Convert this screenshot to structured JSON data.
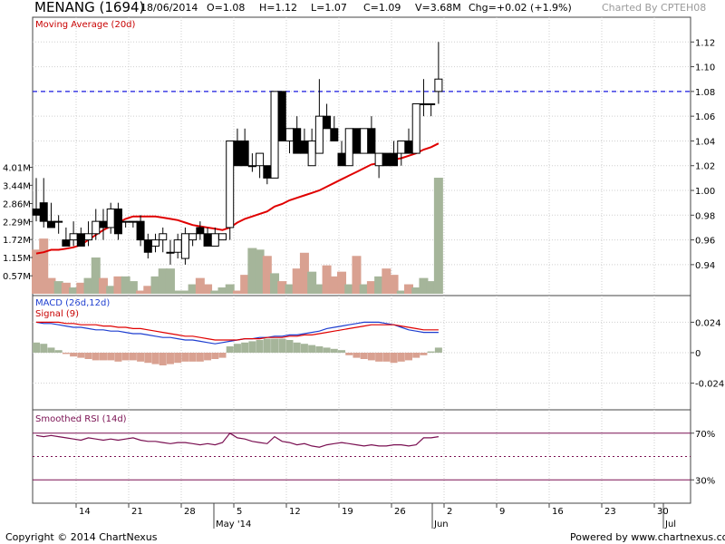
{
  "header": {
    "symbol": "MENANG (1694)",
    "date": "18/06/2014",
    "open": "O=1.08",
    "high": "H=1.12",
    "low": "L=1.07",
    "close": "C=1.09",
    "volume": "V=3.68M",
    "change": "Chg=+0.02 (+1.9%)",
    "charted_by": "Charted By CPTEH08"
  },
  "footer": {
    "copyright": "Copyright © 2014 ChartNexus",
    "powered_by": "Powered by www.chartnexus.com"
  },
  "colors": {
    "up_candle": "#ffffff",
    "down_candle": "#000000",
    "ma_line": "#e00000",
    "vol_up": "#a5b59a",
    "vol_down": "#d9a191",
    "macd_line": "#1f3fd0",
    "signal_line": "#e00000",
    "rsi_line": "#7a1052",
    "resistance": "#1a1adf"
  },
  "chart_data": [
    {
      "type": "candlestick",
      "title": "Moving Average (20d)",
      "ylim": [
        0.915,
        1.14
      ],
      "y_ticks": [
        "1.12",
        "1.10",
        "1.08",
        "1.06",
        "1.04",
        "1.02",
        "1.00",
        "0.98",
        "0.96",
        "0.94"
      ],
      "resistance_level": 1.08,
      "x_tick_labels": [
        "14",
        "21",
        "28",
        "5",
        "12",
        "19",
        "26",
        "2",
        "9",
        "16",
        "23",
        "30"
      ],
      "month_labels": [
        "May '14",
        "Jun",
        "Jul"
      ],
      "candles": [
        {
          "o": 0.985,
          "h": 1.01,
          "l": 0.975,
          "c": 0.98
        },
        {
          "o": 0.99,
          "h": 1.01,
          "l": 0.97,
          "c": 0.975
        },
        {
          "o": 0.975,
          "h": 0.99,
          "l": 0.97,
          "c": 0.97
        },
        {
          "o": 0.975,
          "h": 0.98,
          "l": 0.965,
          "c": 0.975
        },
        {
          "o": 0.96,
          "h": 0.97,
          "l": 0.955,
          "c": 0.955
        },
        {
          "o": 0.96,
          "h": 0.975,
          "l": 0.955,
          "c": 0.965
        },
        {
          "o": 0.965,
          "h": 0.97,
          "l": 0.955,
          "c": 0.955
        },
        {
          "o": 0.96,
          "h": 0.975,
          "l": 0.955,
          "c": 0.965
        },
        {
          "o": 0.965,
          "h": 0.985,
          "l": 0.96,
          "c": 0.975
        },
        {
          "o": 0.975,
          "h": 0.985,
          "l": 0.96,
          "c": 0.97
        },
        {
          "o": 0.97,
          "h": 0.99,
          "l": 0.965,
          "c": 0.985
        },
        {
          "o": 0.985,
          "h": 0.99,
          "l": 0.96,
          "c": 0.965
        },
        {
          "o": 0.975,
          "h": 0.975,
          "l": 0.97,
          "c": 0.975
        },
        {
          "o": 0.975,
          "h": 0.975,
          "l": 0.97,
          "c": 0.975
        },
        {
          "o": 0.975,
          "h": 0.98,
          "l": 0.955,
          "c": 0.96
        },
        {
          "o": 0.96,
          "h": 0.965,
          "l": 0.945,
          "c": 0.95
        },
        {
          "o": 0.955,
          "h": 0.965,
          "l": 0.95,
          "c": 0.96
        },
        {
          "o": 0.96,
          "h": 0.97,
          "l": 0.95,
          "c": 0.965
        },
        {
          "o": 0.95,
          "h": 0.96,
          "l": 0.94,
          "c": 0.95
        },
        {
          "o": 0.95,
          "h": 0.965,
          "l": 0.945,
          "c": 0.96
        },
        {
          "o": 0.945,
          "h": 0.97,
          "l": 0.94,
          "c": 0.965
        },
        {
          "o": 0.96,
          "h": 0.965,
          "l": 0.955,
          "c": 0.965
        },
        {
          "o": 0.97,
          "h": 0.975,
          "l": 0.96,
          "c": 0.965
        },
        {
          "o": 0.965,
          "h": 0.97,
          "l": 0.96,
          "c": 0.955
        },
        {
          "o": 0.955,
          "h": 0.97,
          "l": 0.955,
          "c": 0.965
        },
        {
          "o": 0.96,
          "h": 0.965,
          "l": 0.96,
          "c": 0.965
        },
        {
          "o": 0.97,
          "h": 1.02,
          "l": 0.96,
          "c": 1.04
        },
        {
          "o": 1.04,
          "h": 1.05,
          "l": 1.02,
          "c": 1.02
        },
        {
          "o": 1.04,
          "h": 1.05,
          "l": 1.02,
          "c": 1.02
        },
        {
          "o": 1.02,
          "h": 1.03,
          "l": 1.015,
          "c": 1.02
        },
        {
          "o": 1.02,
          "h": 1.03,
          "l": 1.01,
          "c": 1.03
        },
        {
          "o": 1.02,
          "h": 1.02,
          "l": 1.005,
          "c": 1.01
        },
        {
          "o": 1.01,
          "h": 1.08,
          "l": 1.01,
          "c": 1.08
        },
        {
          "o": 1.08,
          "h": 1.08,
          "l": 1.04,
          "c": 1.04
        },
        {
          "o": 1.04,
          "h": 1.05,
          "l": 1.03,
          "c": 1.05
        },
        {
          "o": 1.05,
          "h": 1.06,
          "l": 1.03,
          "c": 1.03
        },
        {
          "o": 1.04,
          "h": 1.05,
          "l": 1.03,
          "c": 1.03
        },
        {
          "o": 1.02,
          "h": 1.05,
          "l": 1.02,
          "c": 1.04
        },
        {
          "o": 1.03,
          "h": 1.09,
          "l": 1.03,
          "c": 1.06
        },
        {
          "o": 1.06,
          "h": 1.07,
          "l": 1.05,
          "c": 1.05
        },
        {
          "o": 1.05,
          "h": 1.06,
          "l": 1.04,
          "c": 1.04
        },
        {
          "o": 1.03,
          "h": 1.04,
          "l": 1.02,
          "c": 1.02
        },
        {
          "o": 1.02,
          "h": 1.05,
          "l": 1.02,
          "c": 1.05
        },
        {
          "o": 1.05,
          "h": 1.05,
          "l": 1.03,
          "c": 1.03
        },
        {
          "o": 1.03,
          "h": 1.05,
          "l": 1.03,
          "c": 1.05
        },
        {
          "o": 1.05,
          "h": 1.06,
          "l": 1.03,
          "c": 1.03
        },
        {
          "o": 1.02,
          "h": 1.03,
          "l": 1.01,
          "c": 1.03
        },
        {
          "o": 1.03,
          "h": 1.03,
          "l": 1.02,
          "c": 1.02
        },
        {
          "o": 1.03,
          "h": 1.04,
          "l": 1.02,
          "c": 1.02
        },
        {
          "o": 1.03,
          "h": 1.04,
          "l": 1.02,
          "c": 1.04
        },
        {
          "o": 1.04,
          "h": 1.05,
          "l": 1.03,
          "c": 1.03
        },
        {
          "o": 1.03,
          "h": 1.05,
          "l": 1.03,
          "c": 1.07
        },
        {
          "o": 1.07,
          "h": 1.09,
          "l": 1.06,
          "c": 1.07
        },
        {
          "o": 1.07,
          "h": 1.07,
          "l": 1.06,
          "c": 1.07
        },
        {
          "o": 1.08,
          "h": 1.12,
          "l": 1.07,
          "c": 1.09
        }
      ],
      "ma20": [
        0.949,
        0.95,
        0.952,
        0.952,
        0.953,
        0.954,
        0.956,
        0.96,
        0.964,
        0.968,
        0.971,
        0.974,
        0.977,
        0.979,
        0.979,
        0.979,
        0.979,
        0.978,
        0.977,
        0.976,
        0.974,
        0.972,
        0.971,
        0.97,
        0.969,
        0.968,
        0.97,
        0.974,
        0.977,
        0.979,
        0.981,
        0.983,
        0.987,
        0.989,
        0.992,
        0.994,
        0.996,
        0.998,
        1.0,
        1.003,
        1.006,
        1.009,
        1.012,
        1.015,
        1.018,
        1.021,
        1.022,
        1.023,
        1.025,
        1.026,
        1.028,
        1.03,
        1.033,
        1.035,
        1.038
      ],
      "volume_ticks": [
        "4.01M",
        "3.44M",
        "2.86M",
        "2.29M",
        "1.72M",
        "1.15M",
        "0.57M"
      ],
      "volume_max": 4.6,
      "volume": [
        1.4,
        1.75,
        0.5,
        0.4,
        0.35,
        0.2,
        0.35,
        0.5,
        1.15,
        0.5,
        0.25,
        0.55,
        0.55,
        0.4,
        0.1,
        0.25,
        0.55,
        0.8,
        0.8,
        0.1,
        0.1,
        0.3,
        0.5,
        0.3,
        0.1,
        0.2,
        0.3,
        0.1,
        0.6,
        1.45,
        1.4,
        1.2,
        0.65,
        0.4,
        0.3,
        0.8,
        1.3,
        0.7,
        0.3,
        0.9,
        0.55,
        0.7,
        0.3,
        1.2,
        0.3,
        0.4,
        0.55,
        0.8,
        0.6,
        0.1,
        0.3,
        0.2,
        0.5,
        0.4,
        3.68
      ]
    },
    {
      "type": "line",
      "title": "MACD (26d,12d)",
      "signal_title": "Signal (9)",
      "ylim": [
        -0.045,
        0.045
      ],
      "y_ticks": [
        "0.024",
        "0",
        "-0.024"
      ],
      "macd": [
        0.024,
        0.023,
        0.023,
        0.022,
        0.021,
        0.02,
        0.02,
        0.019,
        0.018,
        0.018,
        0.017,
        0.017,
        0.016,
        0.015,
        0.015,
        0.014,
        0.013,
        0.012,
        0.012,
        0.011,
        0.01,
        0.01,
        0.009,
        0.008,
        0.007,
        0.008,
        0.009,
        0.01,
        0.011,
        0.011,
        0.012,
        0.012,
        0.013,
        0.013,
        0.014,
        0.014,
        0.015,
        0.016,
        0.017,
        0.019,
        0.02,
        0.021,
        0.022,
        0.023,
        0.024,
        0.024,
        0.024,
        0.023,
        0.022,
        0.02,
        0.018,
        0.017,
        0.016,
        0.016,
        0.016
      ],
      "signal": [
        0.024,
        0.024,
        0.024,
        0.024,
        0.023,
        0.023,
        0.022,
        0.022,
        0.022,
        0.021,
        0.021,
        0.02,
        0.02,
        0.019,
        0.019,
        0.018,
        0.017,
        0.016,
        0.015,
        0.014,
        0.013,
        0.013,
        0.012,
        0.011,
        0.01,
        0.01,
        0.01,
        0.01,
        0.011,
        0.011,
        0.011,
        0.012,
        0.012,
        0.012,
        0.013,
        0.013,
        0.014,
        0.014,
        0.015,
        0.016,
        0.017,
        0.018,
        0.019,
        0.02,
        0.021,
        0.022,
        0.022,
        0.022,
        0.022,
        0.021,
        0.02,
        0.019,
        0.018,
        0.018,
        0.018
      ],
      "histogram": [
        0.008,
        0.007,
        0.004,
        0.002,
        -0.001,
        -0.003,
        -0.004,
        -0.005,
        -0.006,
        -0.006,
        -0.006,
        -0.007,
        -0.006,
        -0.006,
        -0.007,
        -0.008,
        -0.009,
        -0.01,
        -0.009,
        -0.008,
        -0.007,
        -0.007,
        -0.007,
        -0.006,
        -0.005,
        -0.004,
        0.005,
        0.007,
        0.008,
        0.009,
        0.01,
        0.011,
        0.011,
        0.011,
        0.01,
        0.008,
        0.007,
        0.006,
        0.005,
        0.004,
        0.003,
        0.002,
        -0.002,
        -0.004,
        -0.005,
        -0.006,
        -0.007,
        -0.007,
        -0.008,
        -0.007,
        -0.006,
        -0.004,
        -0.002,
        0.001,
        0.004
      ]
    },
    {
      "type": "line",
      "title": "Smoothed RSI (14d)",
      "ylim": [
        10,
        90
      ],
      "y_ticks": [
        "70%",
        "30%"
      ],
      "overbought": 70,
      "oversold": 30,
      "midline": 50,
      "rsi": [
        68,
        67,
        68,
        67,
        66,
        65,
        64,
        66,
        65,
        64,
        65,
        64,
        65,
        66,
        64,
        63,
        63,
        62,
        61,
        62,
        62,
        61,
        60,
        61,
        60,
        62,
        70,
        66,
        65,
        63,
        62,
        61,
        67,
        63,
        62,
        60,
        61,
        59,
        58,
        60,
        61,
        62,
        61,
        60,
        59,
        60,
        59,
        59,
        60,
        60,
        59,
        60,
        66,
        66,
        67
      ]
    }
  ]
}
